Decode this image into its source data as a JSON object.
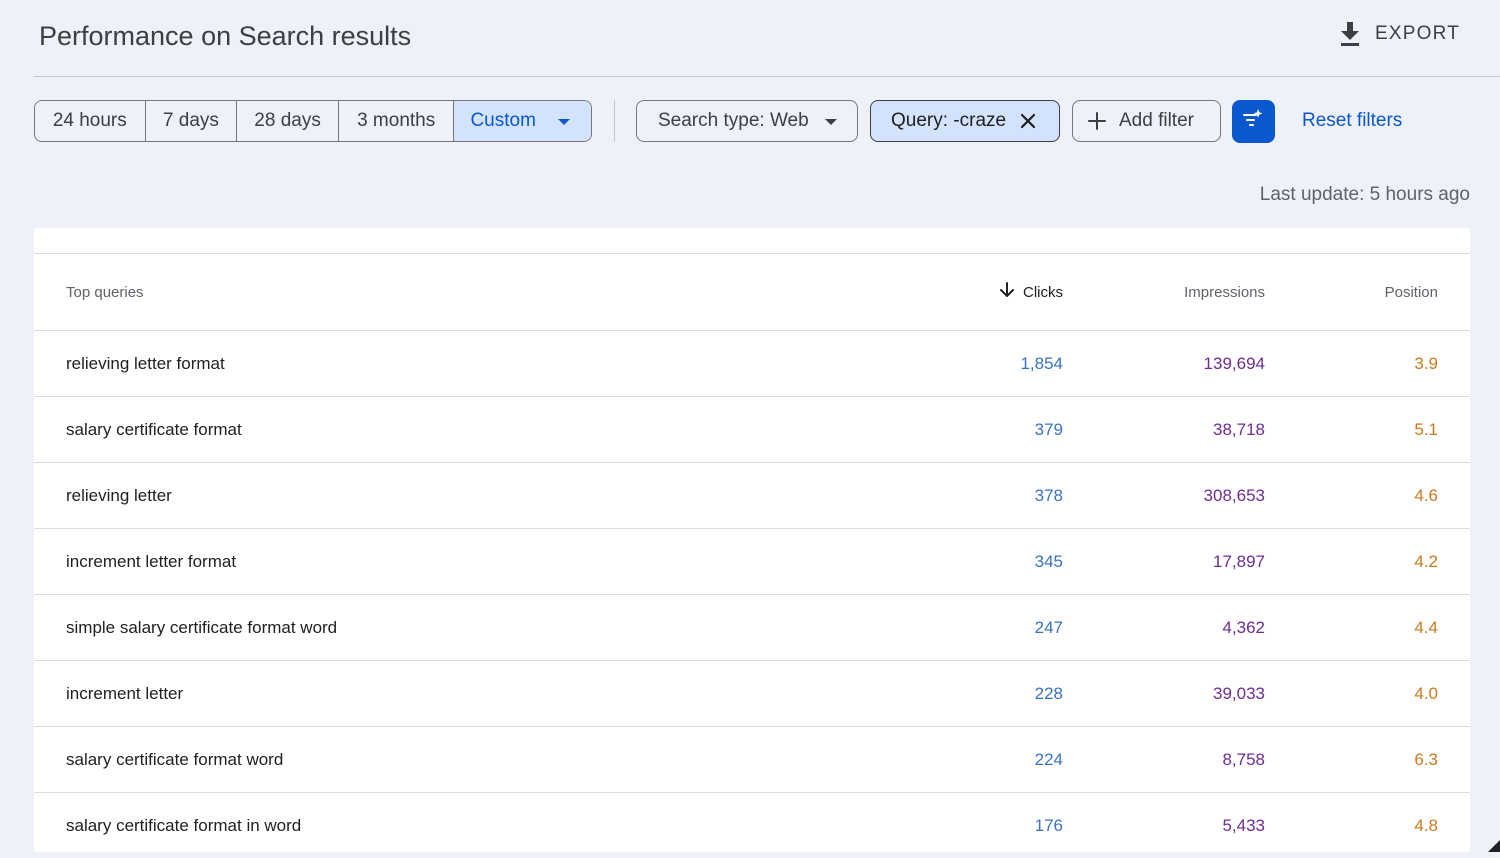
{
  "header": {
    "title": "Performance on Search results",
    "export_label": "EXPORT",
    "export_icon": "download-icon"
  },
  "filters": {
    "date_ranges": [
      "24 hours",
      "7 days",
      "28 days",
      "3 months",
      "Custom"
    ],
    "selected_date_range": "Custom",
    "search_type_label": "Search type: Web",
    "query_filter_label": "Query: -craze",
    "add_filter_label": "Add filter",
    "reset_label": "Reset filters"
  },
  "status": {
    "last_update": "Last update: 5 hours ago"
  },
  "table": {
    "columns": {
      "query": "Top queries",
      "clicks": "Clicks",
      "impressions": "Impressions",
      "position": "Position"
    },
    "sort_column": "Clicks",
    "rows": [
      {
        "query": "relieving letter format",
        "clicks": "1,854",
        "impressions": "139,694",
        "position": "3.9"
      },
      {
        "query": "salary certificate format",
        "clicks": "379",
        "impressions": "38,718",
        "position": "5.1"
      },
      {
        "query": "relieving letter",
        "clicks": "378",
        "impressions": "308,653",
        "position": "4.6"
      },
      {
        "query": "increment letter format",
        "clicks": "345",
        "impressions": "17,897",
        "position": "4.2"
      },
      {
        "query": "simple salary certificate format word",
        "clicks": "247",
        "impressions": "4,362",
        "position": "4.4"
      },
      {
        "query": "increment letter",
        "clicks": "228",
        "impressions": "39,033",
        "position": "4.0"
      },
      {
        "query": "salary certificate format word",
        "clicks": "224",
        "impressions": "8,758",
        "position": "6.3"
      },
      {
        "query": "salary certificate format in word",
        "clicks": "176",
        "impressions": "5,433",
        "position": "4.8"
      }
    ]
  },
  "colors": {
    "clicks": "#3a73c4",
    "impressions": "#6f2c91",
    "position": "#cc7a1f",
    "accent": "#0b57d0",
    "selected_bg": "#d3e3fd"
  }
}
